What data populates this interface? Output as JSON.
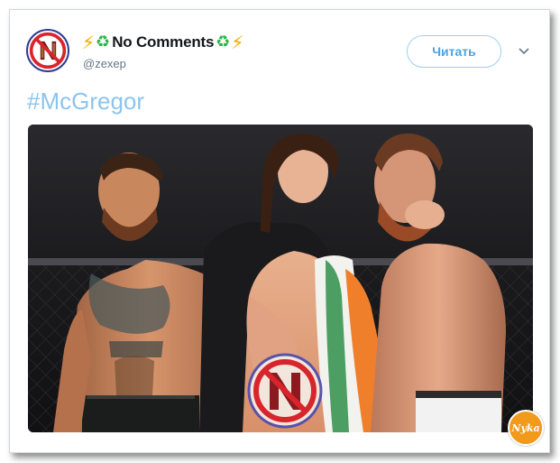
{
  "tweet": {
    "display_name": "No Comments",
    "name_decor_left": [
      "⚡",
      "♻"
    ],
    "name_decor_right": [
      "♻",
      "⚡"
    ],
    "handle": "@zexep",
    "follow_label": "Читать",
    "hashtag": "#McGregor",
    "badge_text": "Nyka"
  },
  "icons": {
    "avatar": "crossed-out-N-logo",
    "menu": "chevron-down-icon",
    "watermark": "crossed-out-N-logo",
    "corner_badge": "site-badge"
  },
  "colors": {
    "follow_text": "#4aa4e6",
    "follow_border": "#9ccff5",
    "hashtag": "#8dc4ec",
    "handle": "#657786",
    "name": "#14171a",
    "avatar_ring": "#2f3d8f",
    "prohibition_red": "#d8242b",
    "badge": "#f29a1b"
  }
}
